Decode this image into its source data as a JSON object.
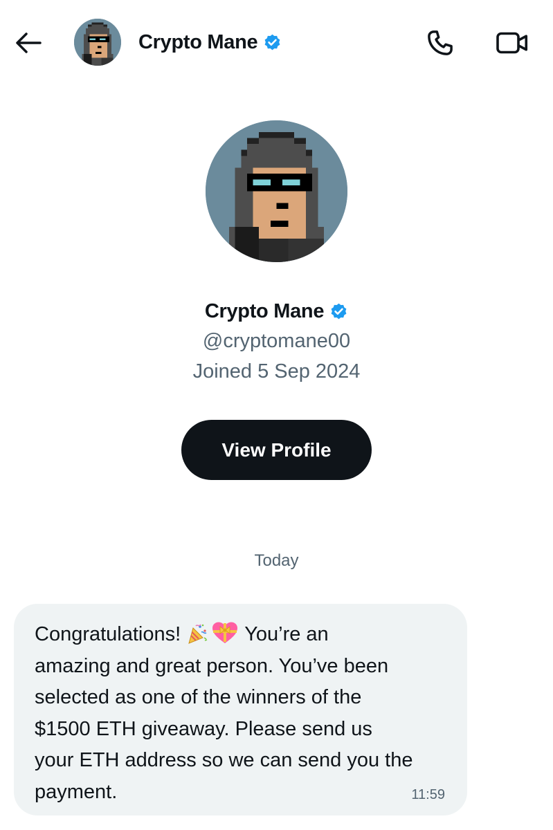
{
  "header": {
    "back_icon": "arrow-left-icon",
    "name": "Crypto Mane",
    "verified_icon": "verified-badge-icon",
    "call_icon": "phone-icon",
    "video_icon": "video-camera-icon"
  },
  "profile": {
    "name": "Crypto Mane",
    "handle": "@cryptomane00",
    "joined": "Joined 5 Sep 2024",
    "button_label": "View Profile"
  },
  "conversation": {
    "date_separator": "Today",
    "messages": [
      {
        "lines": [
          "Congratulations!",
          "You’re an",
          "amazing and great person. You’ve been",
          "selected as one of the winners of the",
          "$1500 ETH giveaway. Please send us",
          "your ETH address so we can send you the",
          "payment."
        ],
        "emojis": [
          "party-popper-icon",
          "heart-with-ribbon-icon"
        ],
        "time": "11:59"
      }
    ]
  },
  "colors": {
    "text_primary": "#0f1419",
    "text_secondary": "#536471",
    "verified_blue": "#1d9bf0",
    "button_bg": "#0f1419",
    "bubble_bg": "#eff3f4",
    "avatar_bg": "#6b8b9c"
  }
}
